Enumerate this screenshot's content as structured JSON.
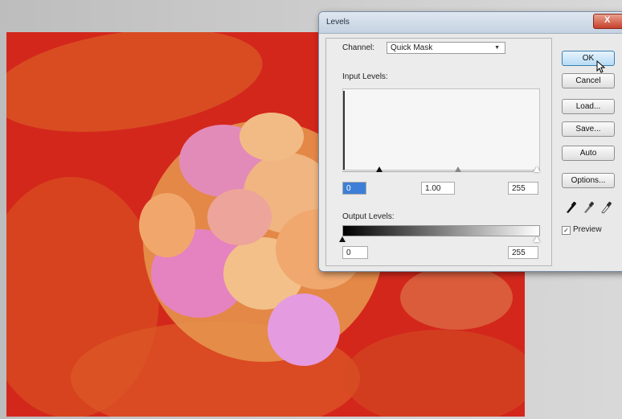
{
  "dialog": {
    "title": "Levels",
    "close_label": "X",
    "channel_label": "Channel:",
    "channel_value": "Quick Mask",
    "input_levels_label": "Input Levels:",
    "input_black": "0",
    "input_gamma": "1.00",
    "input_white": "255",
    "output_levels_label": "Output Levels:",
    "output_black": "0",
    "output_white": "255",
    "buttons": {
      "ok": "OK",
      "cancel": "Cancel",
      "load": "Load...",
      "save": "Save...",
      "auto": "Auto",
      "options": "Options..."
    },
    "preview_label": "Preview",
    "preview_checked": true
  },
  "icons": [
    "eyedropper-black-icon",
    "eyedropper-gray-icon",
    "eyedropper-white-icon",
    "cursor-icon"
  ],
  "colors": {
    "quick_mask_overlay": "#d3271c",
    "default_button": "#b7dbf5"
  }
}
